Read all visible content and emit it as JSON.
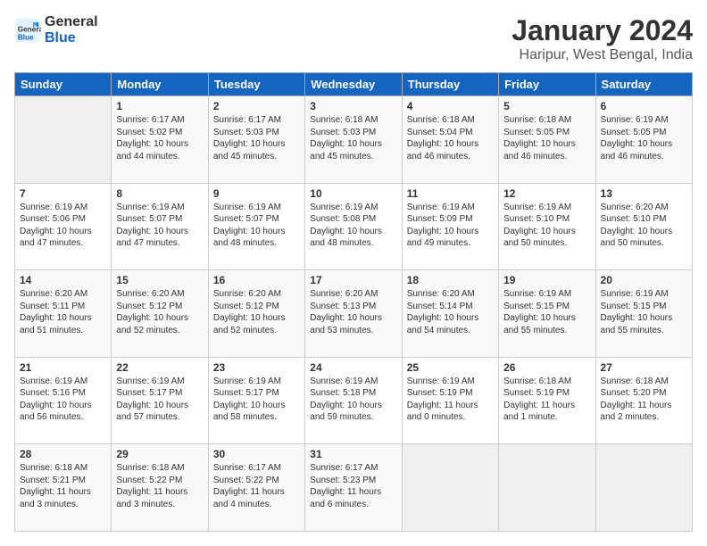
{
  "app": {
    "logo_general": "General",
    "logo_blue": "Blue"
  },
  "title": "January 2024",
  "subtitle": "Haripur, West Bengal, India",
  "headers": [
    "Sunday",
    "Monday",
    "Tuesday",
    "Wednesday",
    "Thursday",
    "Friday",
    "Saturday"
  ],
  "weeks": [
    [
      {
        "day": "",
        "sunrise": "",
        "sunset": "",
        "daylight": ""
      },
      {
        "day": "1",
        "sunrise": "Sunrise: 6:17 AM",
        "sunset": "Sunset: 5:02 PM",
        "daylight": "Daylight: 10 hours and 44 minutes."
      },
      {
        "day": "2",
        "sunrise": "Sunrise: 6:17 AM",
        "sunset": "Sunset: 5:03 PM",
        "daylight": "Daylight: 10 hours and 45 minutes."
      },
      {
        "day": "3",
        "sunrise": "Sunrise: 6:18 AM",
        "sunset": "Sunset: 5:03 PM",
        "daylight": "Daylight: 10 hours and 45 minutes."
      },
      {
        "day": "4",
        "sunrise": "Sunrise: 6:18 AM",
        "sunset": "Sunset: 5:04 PM",
        "daylight": "Daylight: 10 hours and 46 minutes."
      },
      {
        "day": "5",
        "sunrise": "Sunrise: 6:18 AM",
        "sunset": "Sunset: 5:05 PM",
        "daylight": "Daylight: 10 hours and 46 minutes."
      },
      {
        "day": "6",
        "sunrise": "Sunrise: 6:19 AM",
        "sunset": "Sunset: 5:05 PM",
        "daylight": "Daylight: 10 hours and 46 minutes."
      }
    ],
    [
      {
        "day": "7",
        "sunrise": "Sunrise: 6:19 AM",
        "sunset": "Sunset: 5:06 PM",
        "daylight": "Daylight: 10 hours and 47 minutes."
      },
      {
        "day": "8",
        "sunrise": "Sunrise: 6:19 AM",
        "sunset": "Sunset: 5:07 PM",
        "daylight": "Daylight: 10 hours and 47 minutes."
      },
      {
        "day": "9",
        "sunrise": "Sunrise: 6:19 AM",
        "sunset": "Sunset: 5:07 PM",
        "daylight": "Daylight: 10 hours and 48 minutes."
      },
      {
        "day": "10",
        "sunrise": "Sunrise: 6:19 AM",
        "sunset": "Sunset: 5:08 PM",
        "daylight": "Daylight: 10 hours and 48 minutes."
      },
      {
        "day": "11",
        "sunrise": "Sunrise: 6:19 AM",
        "sunset": "Sunset: 5:09 PM",
        "daylight": "Daylight: 10 hours and 49 minutes."
      },
      {
        "day": "12",
        "sunrise": "Sunrise: 6:19 AM",
        "sunset": "Sunset: 5:10 PM",
        "daylight": "Daylight: 10 hours and 50 minutes."
      },
      {
        "day": "13",
        "sunrise": "Sunrise: 6:20 AM",
        "sunset": "Sunset: 5:10 PM",
        "daylight": "Daylight: 10 hours and 50 minutes."
      }
    ],
    [
      {
        "day": "14",
        "sunrise": "Sunrise: 6:20 AM",
        "sunset": "Sunset: 5:11 PM",
        "daylight": "Daylight: 10 hours and 51 minutes."
      },
      {
        "day": "15",
        "sunrise": "Sunrise: 6:20 AM",
        "sunset": "Sunset: 5:12 PM",
        "daylight": "Daylight: 10 hours and 52 minutes."
      },
      {
        "day": "16",
        "sunrise": "Sunrise: 6:20 AM",
        "sunset": "Sunset: 5:12 PM",
        "daylight": "Daylight: 10 hours and 52 minutes."
      },
      {
        "day": "17",
        "sunrise": "Sunrise: 6:20 AM",
        "sunset": "Sunset: 5:13 PM",
        "daylight": "Daylight: 10 hours and 53 minutes."
      },
      {
        "day": "18",
        "sunrise": "Sunrise: 6:20 AM",
        "sunset": "Sunset: 5:14 PM",
        "daylight": "Daylight: 10 hours and 54 minutes."
      },
      {
        "day": "19",
        "sunrise": "Sunrise: 6:19 AM",
        "sunset": "Sunset: 5:15 PM",
        "daylight": "Daylight: 10 hours and 55 minutes."
      },
      {
        "day": "20",
        "sunrise": "Sunrise: 6:19 AM",
        "sunset": "Sunset: 5:15 PM",
        "daylight": "Daylight: 10 hours and 55 minutes."
      }
    ],
    [
      {
        "day": "21",
        "sunrise": "Sunrise: 6:19 AM",
        "sunset": "Sunset: 5:16 PM",
        "daylight": "Daylight: 10 hours and 56 minutes."
      },
      {
        "day": "22",
        "sunrise": "Sunrise: 6:19 AM",
        "sunset": "Sunset: 5:17 PM",
        "daylight": "Daylight: 10 hours and 57 minutes."
      },
      {
        "day": "23",
        "sunrise": "Sunrise: 6:19 AM",
        "sunset": "Sunset: 5:17 PM",
        "daylight": "Daylight: 10 hours and 58 minutes."
      },
      {
        "day": "24",
        "sunrise": "Sunrise: 6:19 AM",
        "sunset": "Sunset: 5:18 PM",
        "daylight": "Daylight: 10 hours and 59 minutes."
      },
      {
        "day": "25",
        "sunrise": "Sunrise: 6:19 AM",
        "sunset": "Sunset: 5:19 PM",
        "daylight": "Daylight: 11 hours and 0 minutes."
      },
      {
        "day": "26",
        "sunrise": "Sunrise: 6:18 AM",
        "sunset": "Sunset: 5:19 PM",
        "daylight": "Daylight: 11 hours and 1 minute."
      },
      {
        "day": "27",
        "sunrise": "Sunrise: 6:18 AM",
        "sunset": "Sunset: 5:20 PM",
        "daylight": "Daylight: 11 hours and 2 minutes."
      }
    ],
    [
      {
        "day": "28",
        "sunrise": "Sunrise: 6:18 AM",
        "sunset": "Sunset: 5:21 PM",
        "daylight": "Daylight: 11 hours and 3 minutes."
      },
      {
        "day": "29",
        "sunrise": "Sunrise: 6:18 AM",
        "sunset": "Sunset: 5:22 PM",
        "daylight": "Daylight: 11 hours and 3 minutes."
      },
      {
        "day": "30",
        "sunrise": "Sunrise: 6:17 AM",
        "sunset": "Sunset: 5:22 PM",
        "daylight": "Daylight: 11 hours and 4 minutes."
      },
      {
        "day": "31",
        "sunrise": "Sunrise: 6:17 AM",
        "sunset": "Sunset: 5:23 PM",
        "daylight": "Daylight: 11 hours and 6 minutes."
      },
      {
        "day": "",
        "sunrise": "",
        "sunset": "",
        "daylight": ""
      },
      {
        "day": "",
        "sunrise": "",
        "sunset": "",
        "daylight": ""
      },
      {
        "day": "",
        "sunrise": "",
        "sunset": "",
        "daylight": ""
      }
    ]
  ]
}
